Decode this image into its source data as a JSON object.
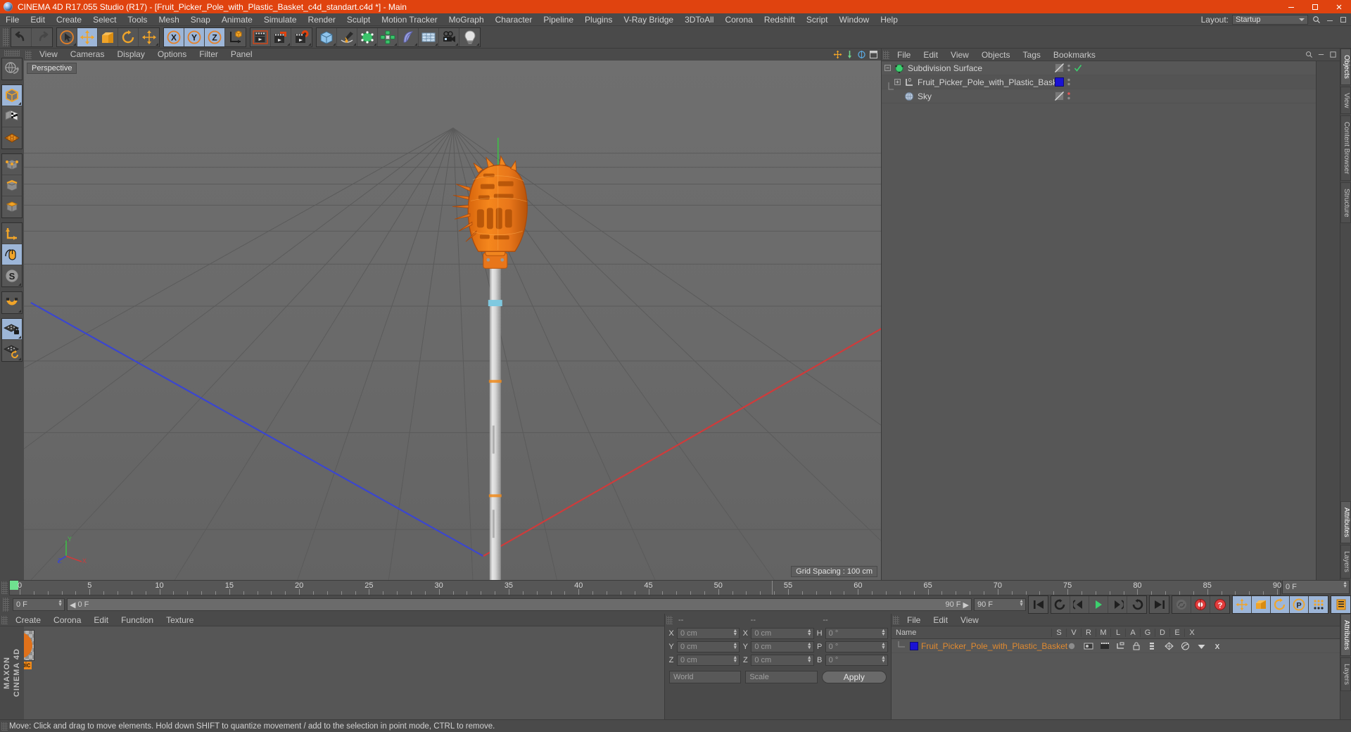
{
  "window": {
    "title": "CINEMA 4D R17.055 Studio (R17) - [Fruit_Picker_Pole_with_Plastic_Basket_c4d_standart.c4d *] - Main",
    "minimize": "–",
    "maximize": "☐",
    "close": "✕"
  },
  "menubar": {
    "items": [
      "File",
      "Edit",
      "Create",
      "Select",
      "Tools",
      "Mesh",
      "Snap",
      "Animate",
      "Simulate",
      "Render",
      "Sculpt",
      "Motion Tracker",
      "MoGraph",
      "Character",
      "Pipeline",
      "Plugins",
      "V-Ray Bridge",
      "3DToAll",
      "Corona",
      "Redshift",
      "Script",
      "Window",
      "Help"
    ],
    "layout_label": "Layout:",
    "layout_value": "Startup"
  },
  "viewport": {
    "menus": [
      "View",
      "Cameras",
      "Display",
      "Options",
      "Filter",
      "Panel"
    ],
    "label": "Perspective",
    "grid_spacing": "Grid Spacing : 100 cm",
    "axis_x": "X",
    "axis_y": "Y",
    "axis_z": "Z"
  },
  "object_manager": {
    "menus": [
      "File",
      "Edit",
      "View",
      "Objects",
      "Tags",
      "Bookmarks"
    ],
    "rows": [
      {
        "name": "Subdivision Surface",
        "depth": 0,
        "icon": "subdivision-surface-icon",
        "tag_color": "",
        "has_check": true
      },
      {
        "name": "Fruit_Picker_Pole_with_Plastic_Basket",
        "depth": 1,
        "icon": "null-object-icon",
        "tag_color": "#1a12d4",
        "has_check": false
      },
      {
        "name": "Sky",
        "depth": 1,
        "icon": "sky-object-icon",
        "tag_color": "",
        "has_check": false
      }
    ]
  },
  "attribute_manager": {
    "menus": [
      "File",
      "Edit",
      "View"
    ],
    "columns": [
      "Name",
      "S",
      "V",
      "R",
      "M",
      "L",
      "A",
      "G",
      "D",
      "E",
      "X"
    ],
    "rows": [
      {
        "name": "Fruit_Picker_Pole_with_Plastic_Basket",
        "color": "#1a12d4"
      }
    ]
  },
  "side_tabs": {
    "right_top": [
      "Objects",
      "View",
      "Content Browser",
      "Structure"
    ],
    "right_bottom": [
      "Attributes",
      "Layers"
    ]
  },
  "timeline": {
    "tick_labels": [
      "0",
      "5",
      "10",
      "15",
      "20",
      "25",
      "30",
      "35",
      "40",
      "45",
      "50",
      "55",
      "60",
      "65",
      "70",
      "75",
      "80",
      "85",
      "90"
    ],
    "tick_values": [
      0,
      5,
      10,
      15,
      20,
      25,
      30,
      35,
      40,
      45,
      50,
      55,
      60,
      65,
      70,
      75,
      80,
      85,
      90
    ],
    "range_start": 0,
    "range_end": 90,
    "current_frame": "0 F",
    "start_field": "0 F",
    "bar_left": "0 F",
    "bar_right": "90 F",
    "end_field": "90 F",
    "preview_min": "0 F",
    "preview_max": "90 F"
  },
  "material_manager": {
    "menus": [
      "Create",
      "Corona",
      "Edit",
      "Function",
      "Texture"
    ],
    "materials": [
      {
        "name": "fruit pic"
      }
    ]
  },
  "coordinates": {
    "head": [
      "--",
      "--",
      "--"
    ],
    "position": [
      {
        "axis": "X",
        "value": "0 cm"
      },
      {
        "axis": "Y",
        "value": "0 cm"
      },
      {
        "axis": "Z",
        "value": "0 cm"
      }
    ],
    "size": [
      {
        "axis": "X",
        "value": "0 cm"
      },
      {
        "axis": "Y",
        "value": "0 cm"
      },
      {
        "axis": "Z",
        "value": "0 cm"
      }
    ],
    "rotation": [
      {
        "axis": "H",
        "value": "0 °"
      },
      {
        "axis": "P",
        "value": "0 °"
      },
      {
        "axis": "B",
        "value": "0 °"
      }
    ],
    "system": "World",
    "mode": "Scale",
    "apply": "Apply"
  },
  "statusbar": {
    "text": "Move: Click and drag to move elements. Hold down SHIFT to quantize movement / add to the selection in point mode, CTRL to remove."
  },
  "brand": {
    "maxon": "MAXON",
    "cinema4d": "CINEMA 4D"
  },
  "colors": {
    "accent_orange": "#e0430f",
    "ui_bg": "#4a4a4a",
    "panel_bg": "#575757",
    "active_blue": "#9db6d8",
    "model_orange": "#f07c1a",
    "text": "#d0d0d0"
  }
}
